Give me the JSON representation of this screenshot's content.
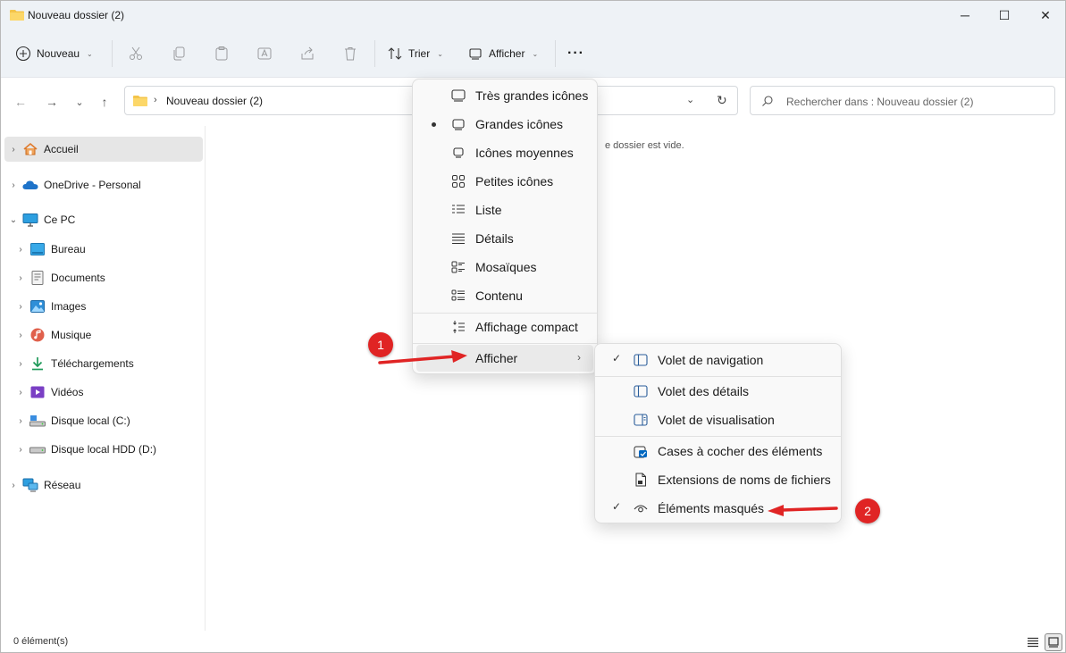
{
  "window": {
    "title": "Nouveau dossier (2)",
    "controls": {
      "minimize": "─",
      "maximize": "☐",
      "close": "✕"
    }
  },
  "commandbar": {
    "new_label": "Nouveau",
    "sort_label": "Trier",
    "view_label": "Afficher",
    "more_label": "···",
    "chevron": "⌄"
  },
  "address": {
    "crumb_separator": "›",
    "crumb": "Nouveau dossier (2)",
    "dropdown": "⌄",
    "refresh": "↻",
    "search_placeholder": "Rechercher dans : Nouveau dossier (2)"
  },
  "nav": {
    "back": "←",
    "forward": "→",
    "recent": "⌄",
    "up": "↑"
  },
  "sidebar": {
    "items": [
      {
        "label": "Accueil",
        "expander": "›"
      },
      {
        "label": "OneDrive - Personal",
        "expander": "›"
      },
      {
        "label": "Ce PC",
        "expander": "⌄"
      },
      {
        "label": "Bureau",
        "expander": "›"
      },
      {
        "label": "Documents",
        "expander": "›"
      },
      {
        "label": "Images",
        "expander": "›"
      },
      {
        "label": "Musique",
        "expander": "›"
      },
      {
        "label": "Téléchargements",
        "expander": "›"
      },
      {
        "label": "Vidéos",
        "expander": "›"
      },
      {
        "label": "Disque local (C:)",
        "expander": "›"
      },
      {
        "label": "Disque local HDD (D:)",
        "expander": "›"
      },
      {
        "label": "Réseau",
        "expander": "›"
      }
    ]
  },
  "content": {
    "empty_message": "e dossier est vide."
  },
  "status": {
    "count": "0 élément(s)"
  },
  "view_menu": {
    "items": [
      {
        "label": "Très grandes icônes"
      },
      {
        "label": "Grandes icônes",
        "selected_marker": "•"
      },
      {
        "label": "Icônes moyennes"
      },
      {
        "label": "Petites icônes"
      },
      {
        "label": "Liste"
      },
      {
        "label": "Détails"
      },
      {
        "label": "Mosaïques"
      },
      {
        "label": "Contenu"
      },
      {
        "label": "Affichage compact"
      },
      {
        "label": "Afficher",
        "submenu_arrow": "›"
      }
    ]
  },
  "show_submenu": {
    "items": [
      {
        "label": "Volet de navigation",
        "check": "✓"
      },
      {
        "label": "Volet des détails"
      },
      {
        "label": "Volet de visualisation"
      },
      {
        "label": "Cases à cocher des éléments"
      },
      {
        "label": "Extensions de noms de fichiers"
      },
      {
        "label": "Éléments masqués",
        "check": "✓"
      }
    ]
  },
  "annotations": {
    "badge1": "1",
    "badge2": "2",
    "color": "#e02424"
  },
  "colors": {
    "folder": "#f4c44a",
    "accent": "#0067c0",
    "titlebar": "#eef2f6"
  }
}
